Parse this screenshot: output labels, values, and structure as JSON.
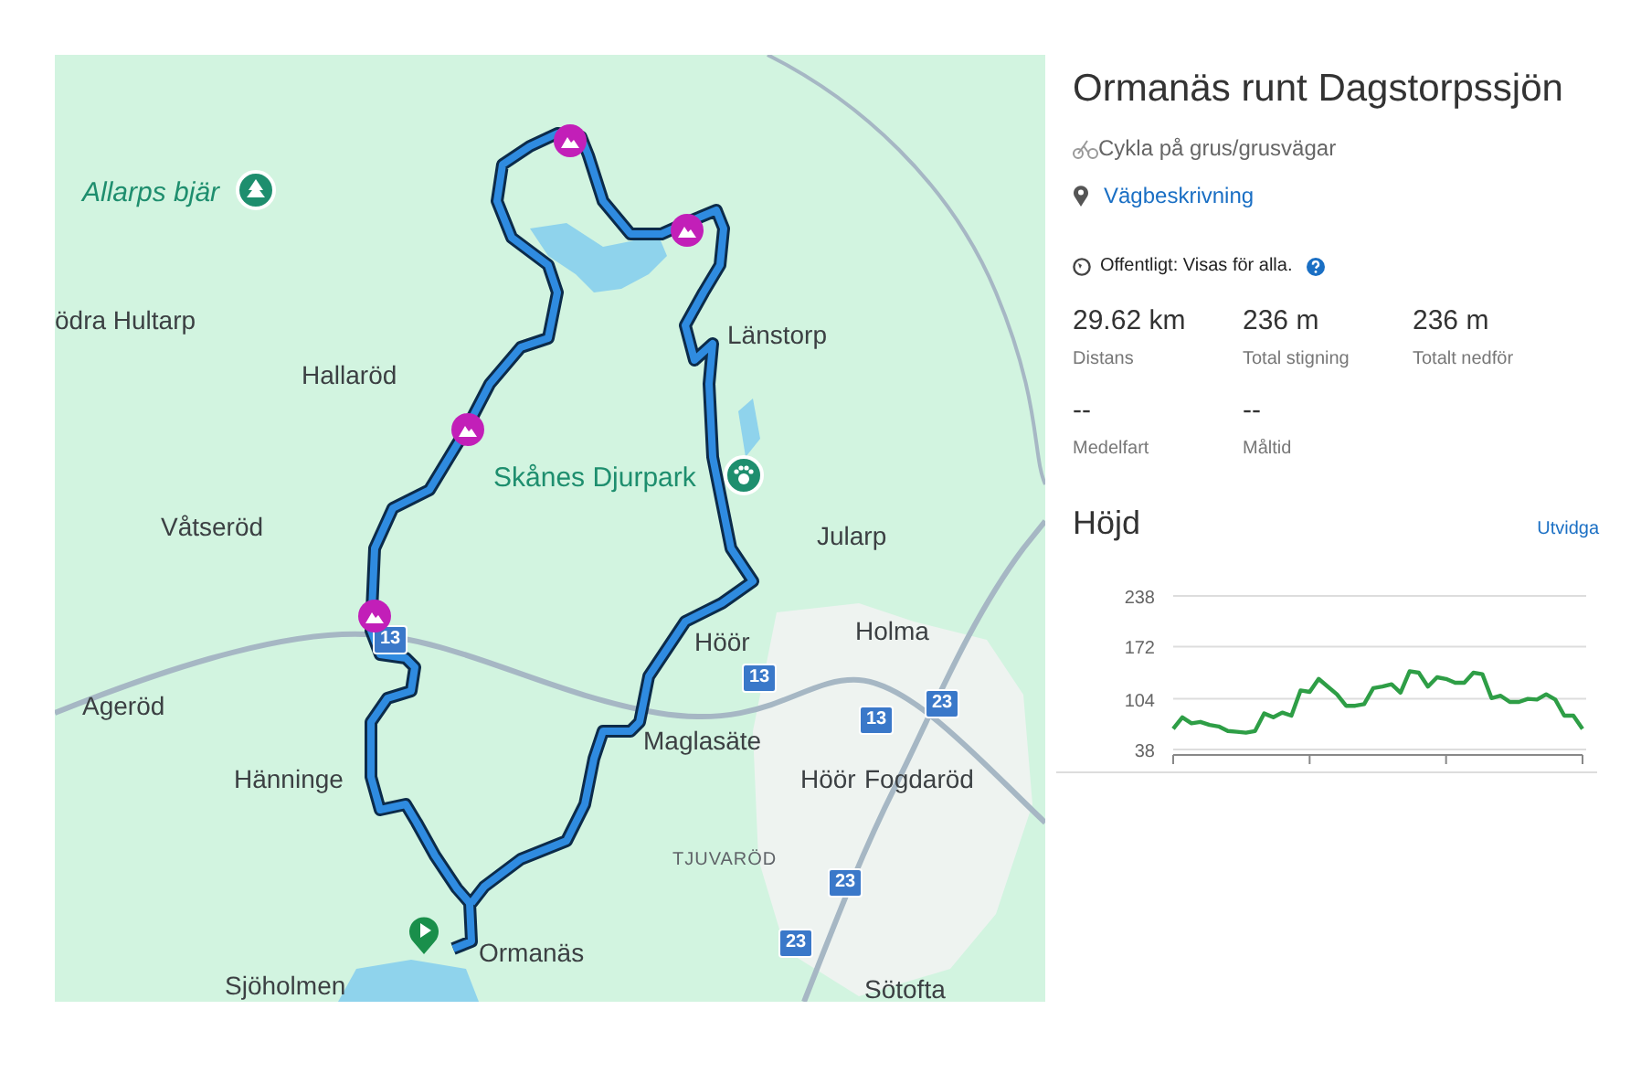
{
  "map": {
    "places": [
      {
        "name": "Allarps bjär",
        "kind": "poi"
      },
      {
        "name": "ödra Hultarp",
        "kind": "town"
      },
      {
        "name": "Länstorp",
        "kind": "town"
      },
      {
        "name": "Hallaröd",
        "kind": "town"
      },
      {
        "name": "Skånes Djurpark",
        "kind": "poi"
      },
      {
        "name": "Våtseröd",
        "kind": "town"
      },
      {
        "name": "Jularp",
        "kind": "town"
      },
      {
        "name": "Höör",
        "kind": "town"
      },
      {
        "name": "Holma",
        "kind": "town"
      },
      {
        "name": "Ageröd",
        "kind": "town"
      },
      {
        "name": "Maglasäte",
        "kind": "town"
      },
      {
        "name": "Hänninge",
        "kind": "town"
      },
      {
        "name": "Höör",
        "kind": "town"
      },
      {
        "name": "Fogdaröd",
        "kind": "town"
      },
      {
        "name": "TJUVARÖD",
        "kind": "district"
      },
      {
        "name": "Ormanäs",
        "kind": "town"
      },
      {
        "name": "Sjöholmen",
        "kind": "town"
      },
      {
        "name": "Sötofta",
        "kind": "town"
      }
    ],
    "road_shields": [
      "13",
      "13",
      "13",
      "23",
      "23",
      "23"
    ]
  },
  "route": {
    "title": "Ormanäs runt Dagstorpssjön",
    "activity": "Cykla på grus/grusvägar",
    "directions_link": "Vägbeskrivning",
    "visibility": "Offentligt: Visas för alla."
  },
  "stats": [
    {
      "value": "29.62 km",
      "label": "Distans"
    },
    {
      "value": "236 m",
      "label": "Total stigning"
    },
    {
      "value": "236 m",
      "label": "Totalt nedför"
    },
    {
      "value": "--",
      "label": "Medelfart"
    },
    {
      "value": "--",
      "label": "Måltid"
    }
  ],
  "elevation": {
    "title": "Höjd",
    "expand_link": "Utvidga",
    "chart_data": {
      "type": "line",
      "ylim": [
        38,
        238
      ],
      "yticks": [
        38,
        104,
        172,
        238
      ],
      "series": [
        {
          "color": "#2e9e46",
          "values": [
            65,
            80,
            72,
            74,
            70,
            68,
            62,
            61,
            60,
            62,
            85,
            80,
            86,
            82,
            115,
            113,
            130,
            120,
            110,
            95,
            95,
            97,
            118,
            120,
            123,
            112,
            140,
            138,
            120,
            132,
            130,
            125,
            125,
            138,
            136,
            105,
            108,
            100,
            100,
            104,
            103,
            110,
            103,
            82,
            82,
            65
          ]
        }
      ]
    }
  }
}
